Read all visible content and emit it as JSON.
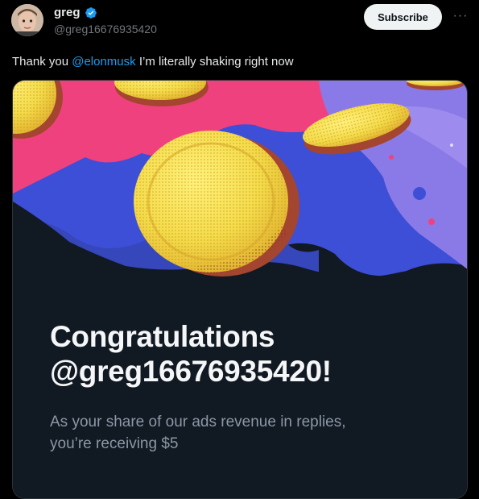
{
  "author": {
    "display_name": "greg",
    "handle": "@greg16676935420",
    "verified_icon": "verified-badge-icon"
  },
  "actions": {
    "subscribe_label": "Subscribe",
    "more_label": "···"
  },
  "tweet": {
    "text_prefix": "Thank you ",
    "mention": "@elonmusk",
    "text_suffix": " I’m literally shaking right now"
  },
  "card": {
    "title_line1": "Congratulations",
    "title_line2": "@greg16676935420!",
    "subtext_line1": "As your share of our ads revenue in replies,",
    "subtext_line2": "you’re receiving $5"
  },
  "colors": {
    "accent": "#1d9bf0",
    "card_bg": "#111923",
    "pink": "#f0417f",
    "blue": "#3d4fd6",
    "purple": "#8a7ae8",
    "coin_yellow": "#f3dc4a"
  }
}
